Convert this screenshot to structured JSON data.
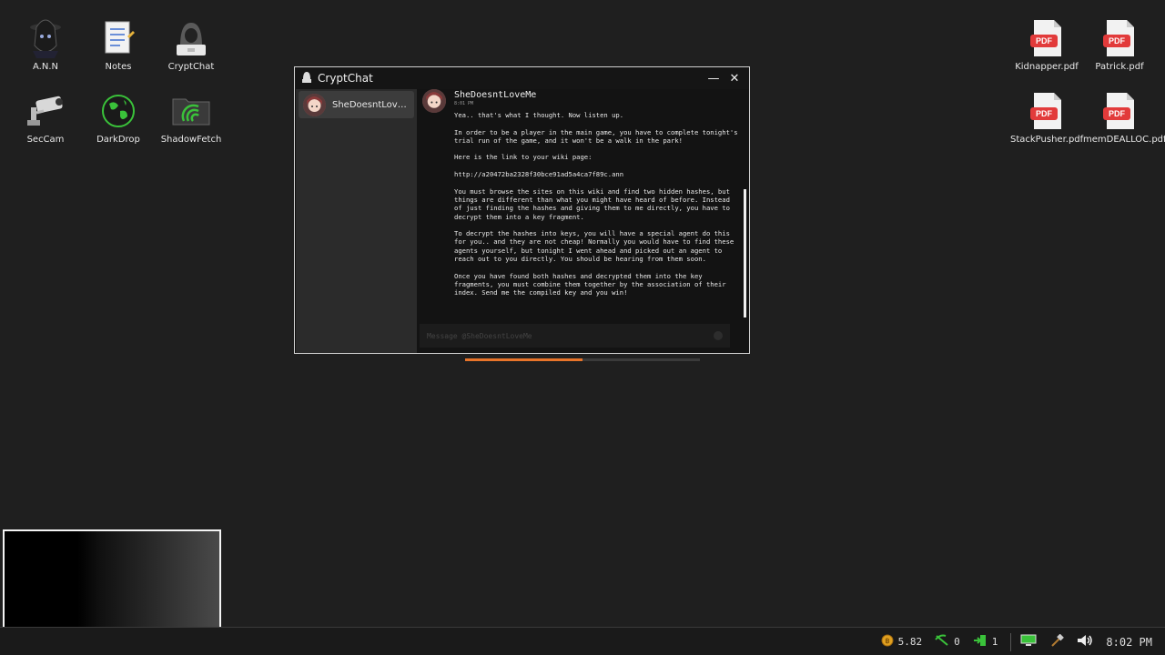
{
  "desktop_icons": [
    {
      "label": "A.N.N",
      "icon": "hooded-figure-icon"
    },
    {
      "label": "Notes",
      "icon": "notepad-icon"
    },
    {
      "label": "CryptChat",
      "icon": "hacker-chat-icon"
    },
    {
      "label": "SecCam",
      "icon": "security-camera-icon"
    },
    {
      "label": "DarkDrop",
      "icon": "globe-icon"
    },
    {
      "label": "ShadowFetch",
      "icon": "folder-signal-icon"
    },
    {
      "label": "Kidnapper.pdf",
      "icon": "pdf-icon"
    },
    {
      "label": "Patrick.pdf",
      "icon": "pdf-icon"
    },
    {
      "label": "StackPusher.pdf",
      "icon": "pdf-icon"
    },
    {
      "label": "memDEALLOC.pdf",
      "icon": "pdf-icon"
    }
  ],
  "pdf_badge": "PDF",
  "window": {
    "title": "CryptChat",
    "minimize_label": "—",
    "close_label": "✕"
  },
  "sidebar": {
    "contacts": [
      {
        "name": "SheDoesntLove..."
      }
    ]
  },
  "chat": {
    "author": "SheDoesntLoveMe",
    "time": "8:01 PM",
    "paragraphs": [
      "Yea.. that's what I thought. Now listen up.",
      "In order to be a player in the main game, you have to complete tonight's trial run of the game, and it won't be a walk in the park!",
      "Here is the link to your wiki page:",
      "http://a20472ba2328f30bce91ad5a4ca7f89c.ann",
      "You must browse the sites on this wiki and find two hidden hashes, but things are different than what you might have heard of before. Instead of just finding the hashes and giving them to me directly, you have to decrypt them into a key fragment.",
      "To decrypt the hashes into keys, you will have a special agent do this for you.. and they are not cheap! Normally you would have to find these agents yourself, but tonight I went ahead and picked out an agent to reach out to you directly. You should be hearing from them soon.",
      "Once you have found both hashes and decrypted them into the key fragments, you must combine them together by the association of their index. Send me the compiled key and you win!"
    ],
    "input_placeholder": "Message @SheDoesntLoveMe"
  },
  "progress": {
    "value": 0.5,
    "color": "#e8742a"
  },
  "taskbar": {
    "coins": "5.82",
    "stat_a": "0",
    "stat_b": "1",
    "clock": "8:02 PM"
  }
}
